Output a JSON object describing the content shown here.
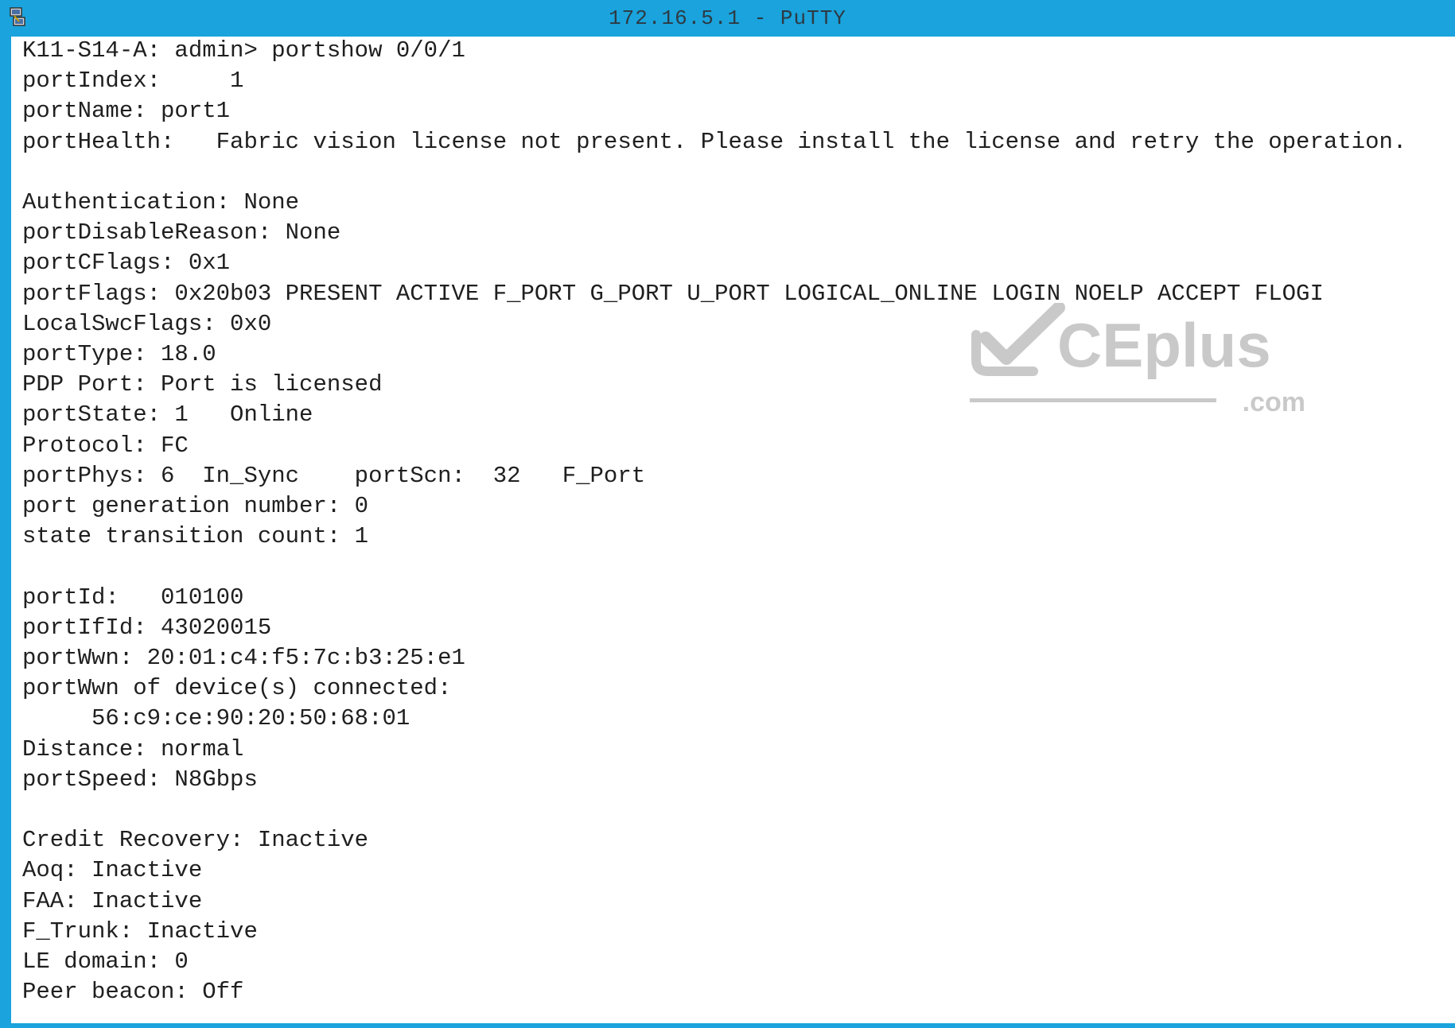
{
  "window": {
    "title": "172.16.5.1 - PuTTY",
    "accent_color": "#1aa3dc",
    "icon": "putty-icon"
  },
  "terminal": {
    "lines": [
      "K11-S14-A: admin> portshow 0/0/1",
      "portIndex:     1",
      "portName: port1",
      "portHealth:   Fabric vision license not present. Please install the license and retry the operation.",
      "",
      "Authentication: None",
      "portDisableReason: None",
      "portCFlags: 0x1",
      "portFlags: 0x20b03 PRESENT ACTIVE F_PORT G_PORT U_PORT LOGICAL_ONLINE LOGIN NOELP ACCEPT FLOGI",
      "LocalSwcFlags: 0x0",
      "portType: 18.0",
      "PDP Port: Port is licensed",
      "portState: 1   Online",
      "Protocol: FC",
      "portPhys: 6  In_Sync    portScn:  32   F_Port",
      "port generation number: 0",
      "state transition count: 1",
      "",
      "portId:   010100",
      "portIfId: 43020015",
      "portWwn: 20:01:c4:f5:7c:b3:25:e1",
      "portWwn of device(s) connected:",
      "     56:c9:ce:90:20:50:68:01",
      "Distance: normal",
      "portSpeed: N8Gbps",
      "",
      "Credit Recovery: Inactive",
      "Aoq: Inactive",
      "FAA: Inactive",
      "F_Trunk: Inactive",
      "LE domain: 0",
      "Peer beacon: Off"
    ]
  },
  "watermark": {
    "text": "CEplus",
    "suffix": ".com",
    "icon": "checkmark-icon"
  }
}
